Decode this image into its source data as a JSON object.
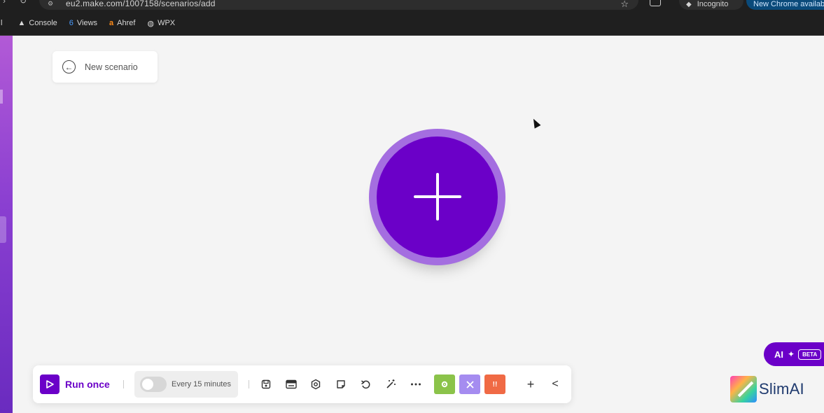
{
  "browser": {
    "url": "eu2.make.com/1007158/scenarios/add",
    "incognito_label": "Incognito",
    "update_label": "New Chrome available",
    "bookmarks": [
      {
        "icon": "app-icon",
        "label": ""
      },
      {
        "icon": "console-icon",
        "label": "Console"
      },
      {
        "icon": "views-icon",
        "label": "Views"
      },
      {
        "icon": "ahrefs-icon",
        "label": "Ahref"
      },
      {
        "icon": "globe-icon",
        "label": "WPX"
      }
    ]
  },
  "canvas": {
    "scenario_title": "New scenario",
    "add_module_icon": "plus-icon"
  },
  "toolbar": {
    "run_label": "Run once",
    "schedule_label": "Every 15 minutes",
    "schedule_enabled": false,
    "tools": [
      "save-icon",
      "scheduling-icon",
      "settings-icon",
      "notes-icon",
      "undo-icon",
      "magic-wand-icon",
      "more-icon"
    ],
    "flow_orange_label": "!!",
    "add_label": "+",
    "collapse_label": "<"
  },
  "ai": {
    "label": "AI",
    "badge": "BETA"
  },
  "watermark": {
    "text": "SlimAI"
  },
  "colors": {
    "brand": "#6b00c8",
    "brand_light": "#a46ee0",
    "green": "#8bc34a",
    "purple": "#a58cf0",
    "orange": "#f06a45"
  }
}
